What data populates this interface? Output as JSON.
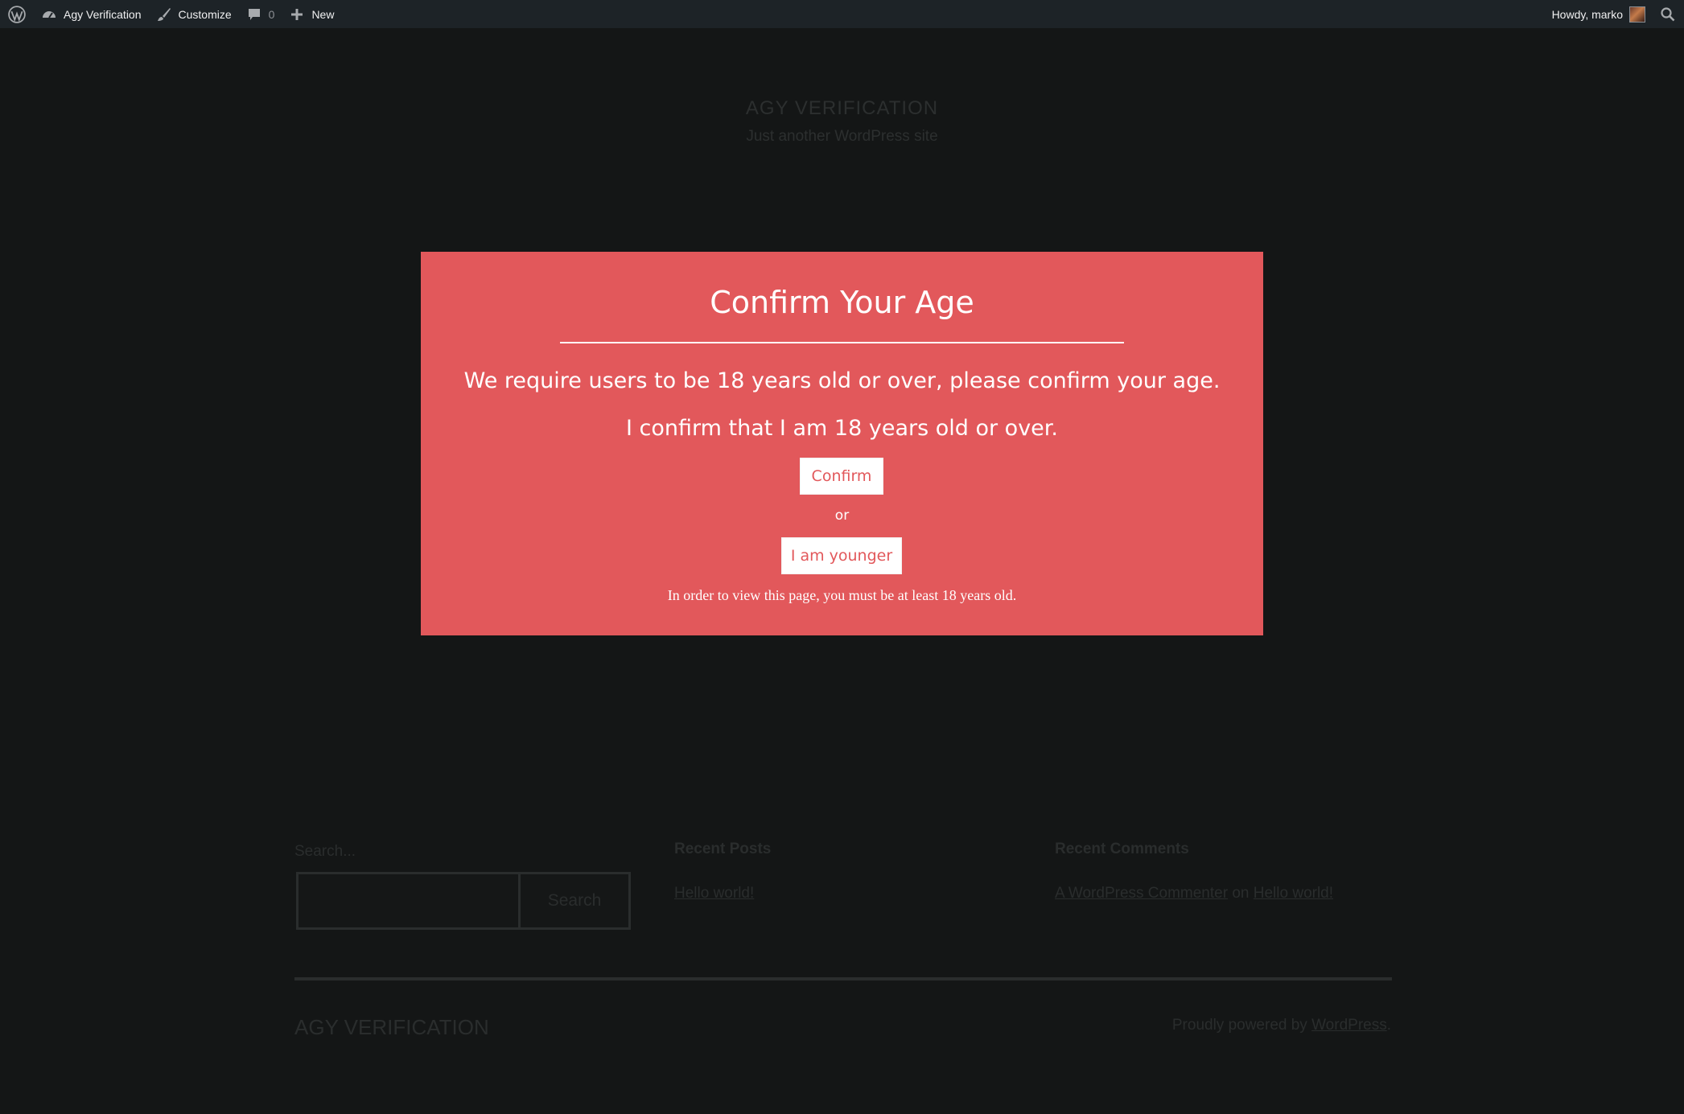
{
  "adminbar": {
    "site_name": "Agy Verification",
    "customize": "Customize",
    "comments_count": "0",
    "new_label": "New",
    "howdy": "Howdy, marko"
  },
  "site": {
    "title": "AGY VERIFICATION",
    "tagline": "Just another WordPress site"
  },
  "widgets": {
    "search_label": "Search...",
    "search_button": "Search",
    "search_value": "",
    "recent_posts_title": "Recent Posts",
    "recent_post_link": "Hello world!",
    "recent_comments_title": "Recent Comments",
    "comment_author": "A WordPress Commenter",
    "comment_on": "on",
    "comment_post": "Hello world!"
  },
  "footer": {
    "title": "AGY VERIFICATION",
    "powered_prefix": "Proudly powered by",
    "powered_link": "WordPress",
    "powered_suffix": "."
  },
  "modal": {
    "title": "Confirm Your Age",
    "line1": "We require users to be 18 years old or over, please confirm your age.",
    "line2": "I confirm that I am 18 years old or over.",
    "confirm_button": "Confirm",
    "or": "or",
    "younger_button": "I am younger",
    "note": "In order to view this page, you must be at least 18 years old."
  },
  "colors": {
    "modal_background": "#e2585b",
    "adminbar_background": "#1d2327",
    "page_background": "#141616"
  }
}
